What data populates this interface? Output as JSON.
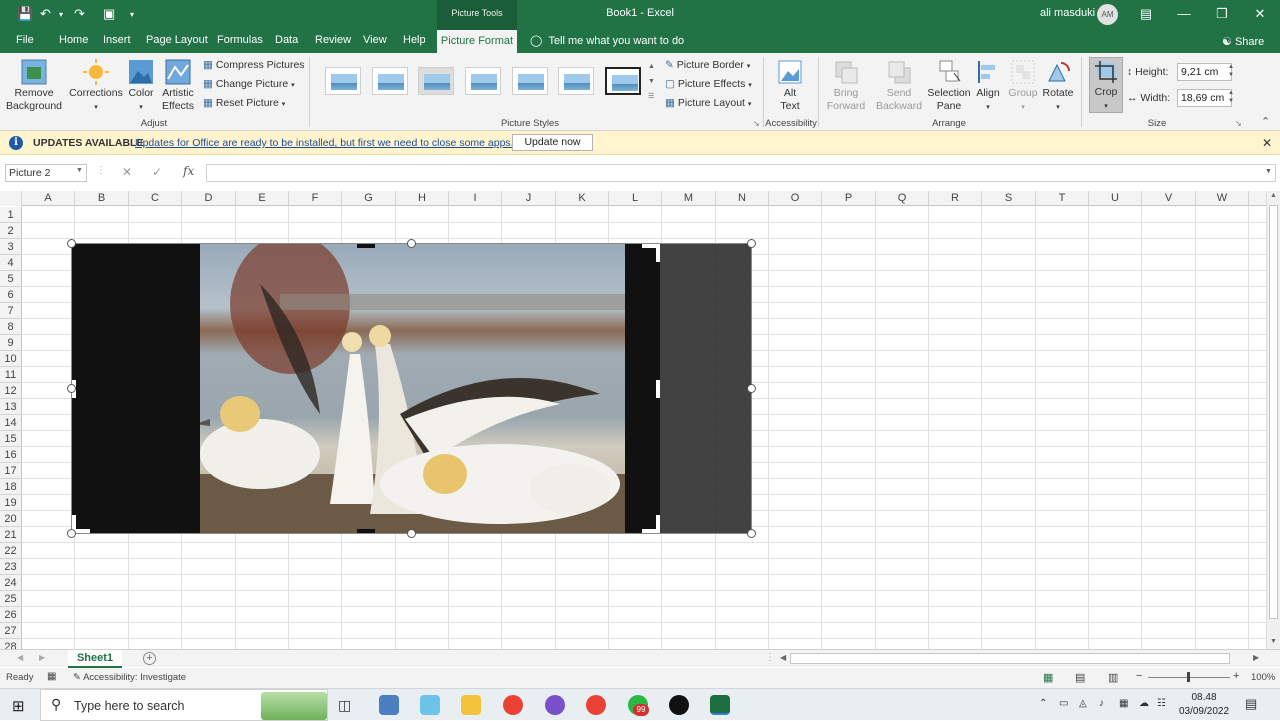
{
  "title_bar": {
    "context_tab_group": "Picture Tools",
    "document_title": "Book1  -  Excel",
    "user_name": "ali masduki",
    "avatar_initials": "AM"
  },
  "menu": {
    "tabs": [
      "File",
      "Home",
      "Insert",
      "Page Layout",
      "Formulas",
      "Data",
      "Review",
      "View",
      "Help"
    ],
    "active_tab": "Picture Format",
    "tell_me": "Tell me what you want to do",
    "share": "Share"
  },
  "ribbon": {
    "remove_background": "Remove Background",
    "corrections": "Corrections",
    "color": "Color",
    "artistic_effects": "Artistic Effects",
    "compress_pictures": "Compress Pictures",
    "change_picture": "Change Picture",
    "reset_picture": "Reset Picture",
    "group_adjust": "Adjust",
    "group_picture_styles": "Picture Styles",
    "picture_border": "Picture Border",
    "picture_effects": "Picture Effects",
    "picture_layout": "Picture Layout",
    "alt_text": "Alt Text",
    "group_accessibility": "Accessibility",
    "bring_forward": "Bring Forward",
    "send_backward": "Send Backward",
    "selection_pane": "Selection Pane",
    "align": "Align",
    "group": "Group",
    "rotate": "Rotate",
    "group_arrange": "Arrange",
    "crop": "Crop",
    "height_label": "Height:",
    "height_value": "9,21 cm",
    "width_label": "Width:",
    "width_value": "18,69 cm",
    "group_size": "Size"
  },
  "update_bar": {
    "title": "UPDATES AVAILABLE",
    "message": "Updates for Office are ready to be installed, but first we need to close some apps.",
    "button": "Update now"
  },
  "formula_bar": {
    "name_box": "Picture 2",
    "fx": "fx"
  },
  "grid": {
    "columns": [
      "A",
      "B",
      "C",
      "D",
      "E",
      "F",
      "G",
      "H",
      "I",
      "J",
      "K",
      "L",
      "M",
      "N",
      "O",
      "P",
      "Q",
      "R",
      "S",
      "T",
      "U",
      "V",
      "W"
    ],
    "rows": [
      "1",
      "2",
      "3",
      "4",
      "5",
      "6",
      "7",
      "8",
      "9",
      "10",
      "11",
      "12",
      "13",
      "14",
      "15",
      "16",
      "17",
      "18",
      "19",
      "20",
      "21",
      "22",
      "23",
      "24",
      "25",
      "26",
      "27",
      "28"
    ]
  },
  "sheets": {
    "tabs": [
      "Sheet1"
    ]
  },
  "status": {
    "ready": "Ready",
    "accessibility": "Accessibility: Investigate",
    "zoom": "100%"
  },
  "taskbar": {
    "search_placeholder": "Type here to search",
    "badge": "99",
    "time": "08.48",
    "date": "03/09/2022"
  },
  "colors": {
    "excel_green": "#217346",
    "ribbon_bg": "#f3f3f3",
    "update_bar_bg": "#fff4ce"
  }
}
